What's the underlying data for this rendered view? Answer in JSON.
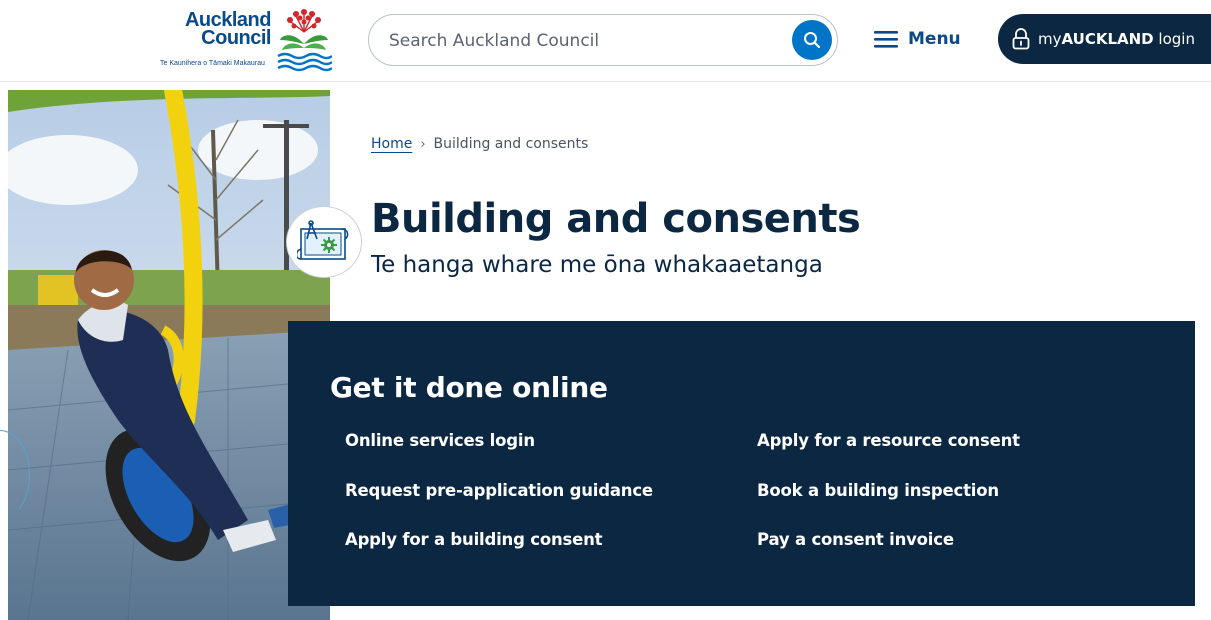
{
  "logo": {
    "line1": "Auckland",
    "line2": "Council",
    "tagline": "Te Kaunihera o Tāmaki Makaurau"
  },
  "search": {
    "placeholder": "Search Auckland Council"
  },
  "menu": {
    "label": "Menu"
  },
  "login": {
    "prefix": "my",
    "brand": "AUCKLAND",
    "suffix": " login"
  },
  "breadcrumb": {
    "home": "Home",
    "separator": "›",
    "current": "Building and consents"
  },
  "page": {
    "title": "Building and consents",
    "subtitle": "Te hanga whare me ōna whakaaetanga"
  },
  "online": {
    "title": "Get it done online",
    "links": [
      "Online services login",
      "Apply for a resource consent",
      "Request pre-application guidance",
      "Book a building inspection",
      "Apply for a building consent",
      "Pay a consent invoice"
    ]
  },
  "icons": {
    "search": "search-icon",
    "menu": "hamburger-icon",
    "login": "padlock-icon",
    "category": "building-plan-icon"
  },
  "colors": {
    "brand_blue": "#0a4a8a",
    "navy": "#0b2742",
    "search_button": "#0074c7",
    "logo_red": "#d3262b",
    "logo_green": "#3a9b3d"
  }
}
